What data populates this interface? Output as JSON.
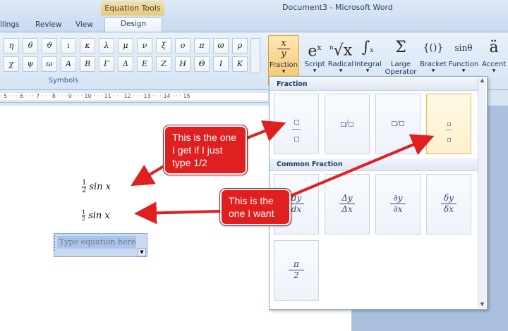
{
  "window": {
    "title": "Document3 - Microsoft Word",
    "contextual_tab_group": "Equation Tools"
  },
  "tabs": [
    {
      "label": "llings",
      "active": false
    },
    {
      "label": "Review",
      "active": false
    },
    {
      "label": "View",
      "active": false
    },
    {
      "label": "Design",
      "active": true
    }
  ],
  "symbols": {
    "group_label": "Symbols",
    "row1": [
      "η",
      "θ",
      "ϑ",
      "ι",
      "κ",
      "λ",
      "μ",
      "ν",
      "ξ",
      "ο",
      "π",
      "ϖ",
      "ρ"
    ],
    "row2": [
      "χ",
      "ψ",
      "ω",
      "Α",
      "Β",
      "Γ",
      "Δ",
      "Ε",
      "Ζ",
      "Η",
      "Θ",
      "Ι",
      "Κ"
    ]
  },
  "structures": [
    {
      "label": "Fraction",
      "glyph": "x/y",
      "active": true
    },
    {
      "label": "Script",
      "glyph": "eˣ",
      "active": false
    },
    {
      "label": "Radical",
      "glyph": "ⁿ√x",
      "active": false
    },
    {
      "label": "Integral",
      "glyph": "∫",
      "active": false
    },
    {
      "label": "Large Operator",
      "glyph": "Σ",
      "active": false
    },
    {
      "label": "Bracket",
      "glyph": "{()}",
      "active": false
    },
    {
      "label": "Function",
      "glyph": "sinθ",
      "active": false
    },
    {
      "label": "Accent",
      "glyph": "ä",
      "active": false
    }
  ],
  "ruler": {
    "ticks": "· 5 · · · 6 · · · 7 · · · 8 · · · 9 · · · 10 · · · 11 · · · 12 · · · 13 · · · 14 · · · 15"
  },
  "document": {
    "eq1": {
      "num": "1",
      "den": "2",
      "rest": "sin x"
    },
    "eq2": {
      "num": "1",
      "den": "2",
      "rest": "sin x"
    },
    "equation_placeholder": "Type equation here."
  },
  "gallery": {
    "section_fraction": "Fraction",
    "section_common": "Common Fraction",
    "fraction_items": [
      {
        "name": "stacked-fraction",
        "selected": false
      },
      {
        "name": "skewed-fraction",
        "selected": false
      },
      {
        "name": "linear-fraction",
        "selected": false
      },
      {
        "name": "small-fraction",
        "selected": true
      }
    ],
    "common_items": [
      {
        "num": "dy",
        "den": "dx"
      },
      {
        "num": "Δy",
        "den": "Δx"
      },
      {
        "num": "∂y",
        "den": "∂x"
      },
      {
        "num": "δy",
        "den": "δx"
      },
      {
        "num": "π",
        "den": "2"
      }
    ]
  },
  "callouts": {
    "first": "This is the one I get if I just type 1/2",
    "second": "This is the one I want"
  },
  "colors": {
    "callout_red": "#e02020",
    "active_structure": "#f6c466",
    "ribbon_blue": "#d6e4f4"
  }
}
